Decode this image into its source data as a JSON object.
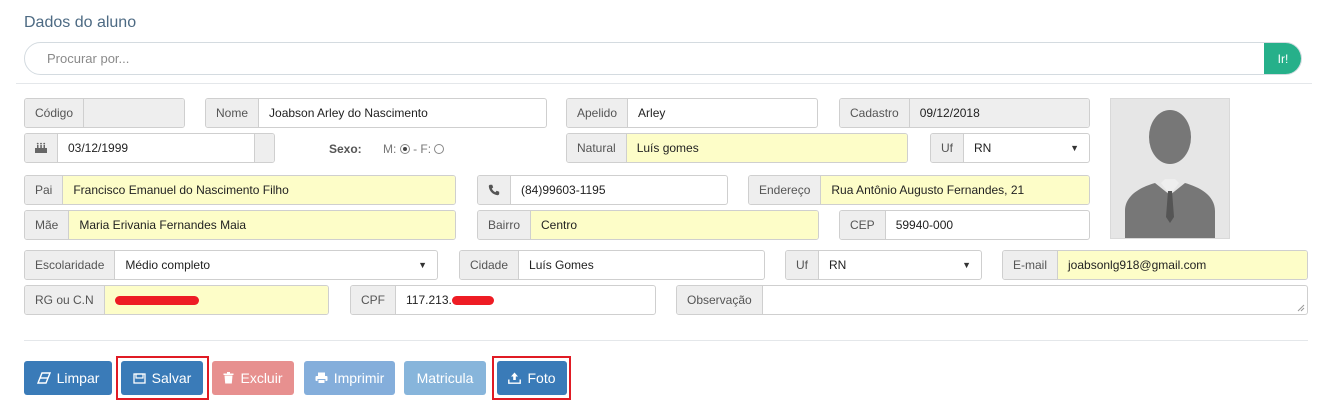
{
  "header": {
    "title": "Dados do aluno"
  },
  "search": {
    "placeholder": "Procurar por...",
    "button_label": "Ir!"
  },
  "form": {
    "codigo": {
      "label": "Código",
      "value": ""
    },
    "nome": {
      "label": "Nome",
      "value": "Joabson Arley do Nascimento"
    },
    "apelido": {
      "label": "Apelido",
      "value": "Arley"
    },
    "cadastro": {
      "label": "Cadastro",
      "value": "09/12/2018"
    },
    "nascimento": {
      "icon": "birthday-cake-icon",
      "value": "03/12/1999"
    },
    "sexo": {
      "label": "Sexo:",
      "m_label": "M:",
      "sep": "-",
      "f_label": "F:",
      "selected": "M"
    },
    "natural": {
      "label": "Natural",
      "value": "Luís gomes"
    },
    "uf1": {
      "label": "Uf",
      "value": "RN"
    },
    "pai": {
      "label": "Pai",
      "value": "Francisco Emanuel do Nascimento Filho"
    },
    "telefone": {
      "icon": "phone-icon",
      "value": "(84)99603-1195"
    },
    "endereco": {
      "label": "Endereço",
      "value": "Rua Antônio Augusto Fernandes, 21"
    },
    "mae": {
      "label": "Mãe",
      "value": "Maria Erivania Fernandes Maia"
    },
    "bairro": {
      "label": "Bairro",
      "value": "Centro"
    },
    "cep": {
      "label": "CEP",
      "value": "59940-000"
    },
    "escolaridade": {
      "label": "Escolaridade",
      "value": "Médio completo"
    },
    "cidade": {
      "label": "Cidade",
      "value": "Luís Gomes"
    },
    "uf2": {
      "label": "Uf",
      "value": "RN"
    },
    "email": {
      "label": "E-mail",
      "value": "joabsonlg918@gmail.com"
    },
    "rg": {
      "label": "RG ou C.N",
      "value_redacted": true
    },
    "cpf": {
      "label": "CPF",
      "value": "117.213."
    },
    "observacao": {
      "label": "Observação",
      "value": ""
    }
  },
  "photo": {
    "icon": "user-silhouette-icon"
  },
  "actions": {
    "limpar": "Limpar",
    "salvar": "Salvar",
    "excluir": "Excluir",
    "imprimir": "Imprimir",
    "matricula": "Matricula",
    "foto": "Foto"
  },
  "colors": {
    "highlight_field": "#fdfdc8",
    "primary_button": "#3a7bb8",
    "danger_button": "#e7908f",
    "search_button": "#26b08a",
    "annotation_box": "#e01b24"
  }
}
